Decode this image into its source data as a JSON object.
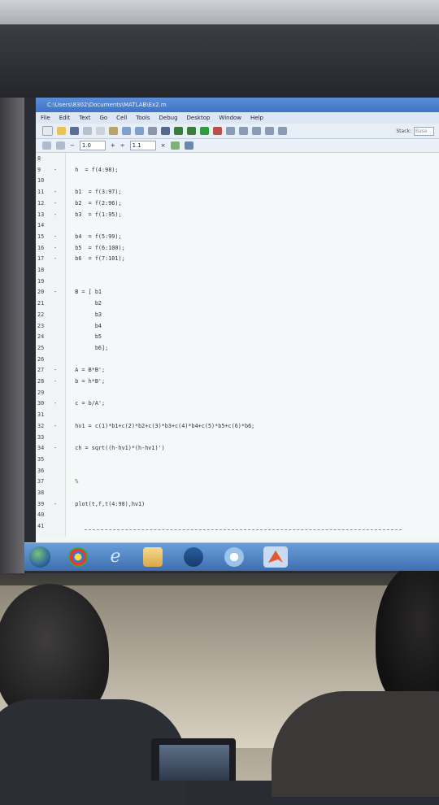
{
  "window": {
    "title": "C:\\Users\\8302\\Documents\\MATLAB\\Ex2.m"
  },
  "menu": [
    "File",
    "Edit",
    "Text",
    "Go",
    "Cell",
    "Tools",
    "Debug",
    "Desktop",
    "Window",
    "Help"
  ],
  "toolbar": {
    "stack_label": "Stack:",
    "stack_value": "Base"
  },
  "cellbar": {
    "minus": "−",
    "value1": "1.0",
    "plus": "+",
    "divide": "÷",
    "value2": "1.1",
    "close": "×"
  },
  "code_lines": [
    {
      "n": "8",
      "dash": "",
      "code": ""
    },
    {
      "n": "9",
      "dash": "-",
      "code": "   h  = f(4:98);"
    },
    {
      "n": "10",
      "dash": "",
      "code": ""
    },
    {
      "n": "11",
      "dash": "-",
      "code": "   b1  = f(3:97);"
    },
    {
      "n": "12",
      "dash": "-",
      "code": "   b2  = f(2:96);"
    },
    {
      "n": "13",
      "dash": "-",
      "code": "   b3  = f(1:95);"
    },
    {
      "n": "14",
      "dash": "",
      "code": ""
    },
    {
      "n": "15",
      "dash": "-",
      "code": "   b4  = f(5:99);"
    },
    {
      "n": "16",
      "dash": "-",
      "code": "   b5  = f(6:100);"
    },
    {
      "n": "17",
      "dash": "-",
      "code": "   b6  = f(7:101);"
    },
    {
      "n": "18",
      "dash": "",
      "code": ""
    },
    {
      "n": "19",
      "dash": "",
      "code": ""
    },
    {
      "n": "20",
      "dash": "-",
      "code": "   B = [ b1"
    },
    {
      "n": "21",
      "dash": "",
      "code": "         b2"
    },
    {
      "n": "22",
      "dash": "",
      "code": "         b3"
    },
    {
      "n": "23",
      "dash": "",
      "code": "         b4"
    },
    {
      "n": "24",
      "dash": "",
      "code": "         b5"
    },
    {
      "n": "25",
      "dash": "",
      "code": "         b6];"
    },
    {
      "n": "26",
      "dash": "",
      "code": ""
    },
    {
      "n": "27",
      "dash": "-",
      "code": "   A = B*B';"
    },
    {
      "n": "28",
      "dash": "-",
      "code": "   b = h*B';"
    },
    {
      "n": "29",
      "dash": "",
      "code": ""
    },
    {
      "n": "30",
      "dash": "-",
      "code": "   c = b/A';"
    },
    {
      "n": "31",
      "dash": "",
      "code": ""
    },
    {
      "n": "32",
      "dash": "-",
      "code": "   hv1 = c(1)*b1+c(2)*b2+c(3)*b3+c(4)*b4+c(5)*b5+c(6)*b6;"
    },
    {
      "n": "33",
      "dash": "",
      "code": ""
    },
    {
      "n": "34",
      "dash": "-",
      "code": "   ch = sqrt((h-hv1)*(h-hv1)')"
    },
    {
      "n": "35",
      "dash": "",
      "code": ""
    },
    {
      "n": "36",
      "dash": "",
      "code": ""
    },
    {
      "n": "37",
      "dash": "",
      "code": "   %"
    },
    {
      "n": "38",
      "dash": "",
      "code": ""
    },
    {
      "n": "39",
      "dash": "-",
      "code": "   plot(t,f,t(4:98),hv1)"
    },
    {
      "n": "40",
      "dash": "",
      "code": ""
    },
    {
      "n": "41",
      "dash": "",
      "code": ""
    }
  ],
  "taskbar_icons": [
    "start-button",
    "chrome",
    "internet-explorer",
    "file-explorer",
    "media-player",
    "messenger",
    "matlab"
  ]
}
